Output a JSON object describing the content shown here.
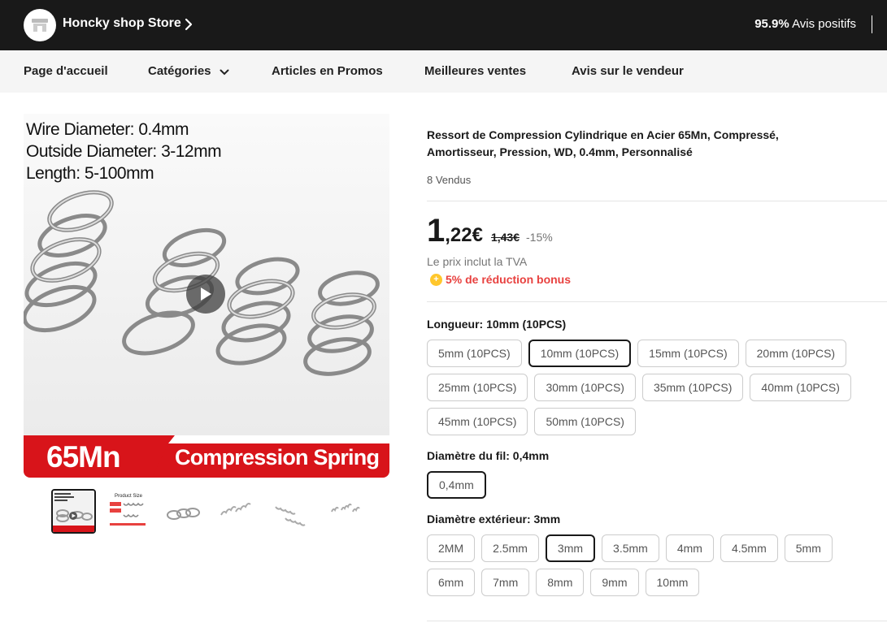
{
  "store": {
    "name": "Honcky shop Store",
    "rating_value": "95.9%",
    "rating_label": "Avis positifs"
  },
  "nav": {
    "home": "Page d'accueil",
    "categories": "Catégories",
    "promos": "Articles en Promos",
    "best": "Meilleures ventes",
    "reviews": "Avis sur le vendeur"
  },
  "gallery": {
    "spec1": "Wire Diameter: 0.4mm",
    "spec2": "Outside Diameter: 3-12mm",
    "spec3": "Length: 5-100mm",
    "banner_left": "65Mn",
    "banner_right": "Compression Spring",
    "thumb2_label": "Product Size",
    "thumb_count": 6
  },
  "product": {
    "title": "Ressort de Compression Cylindrique en Acier 65Mn, Compressé, Amortisseur, Pression, WD, 0.4mm, Personnalisé",
    "sold": "8 Vendus",
    "price_int": "1",
    "price_dec": ",22€",
    "price_old": "1,43€",
    "discount": "-15%",
    "vat": "Le prix inclut la TVA",
    "bonus": "5% de réduction bonus"
  },
  "attributes": {
    "length_label": "Longueur: 10mm (10PCS)",
    "length_options": [
      "5mm (10PCS)",
      "10mm (10PCS)",
      "15mm (10PCS)",
      "20mm (10PCS)",
      "25mm (10PCS)",
      "30mm (10PCS)",
      "35mm (10PCS)",
      "40mm (10PCS)",
      "45mm (10PCS)",
      "50mm (10PCS)"
    ],
    "length_selected": "10mm (10PCS)",
    "wire_label": "Diamètre du fil: 0,4mm",
    "wire_options": [
      "0,4mm"
    ],
    "wire_selected": "0,4mm",
    "outer_label": "Diamètre extérieur: 3mm",
    "outer_options": [
      "2MM",
      "2.5mm",
      "3mm",
      "3.5mm",
      "4mm",
      "4.5mm",
      "5mm",
      "6mm",
      "7mm",
      "8mm",
      "9mm",
      "10mm"
    ],
    "outer_selected": "3mm"
  },
  "colors": {
    "header_bg": "#191919",
    "accent_red": "#e8413f",
    "banner_red": "#d8141a",
    "coin": "#ffc72c"
  }
}
